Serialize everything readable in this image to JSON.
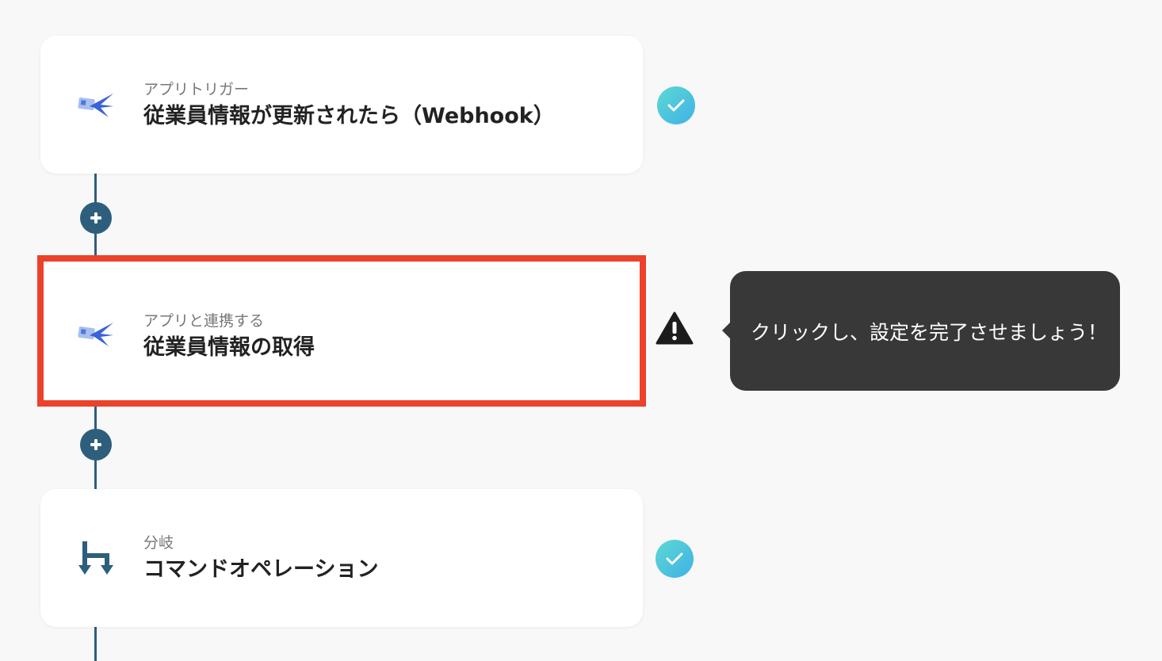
{
  "steps": [
    {
      "subtitle": "アプリトリガー",
      "title": "従業員情報が更新されたら（Webhook）",
      "icon": "app-bird-icon",
      "status": "complete"
    },
    {
      "subtitle": "アプリと連携する",
      "title": "従業員情報の取得",
      "icon": "app-bird-icon",
      "status": "warning",
      "highlighted": true
    },
    {
      "subtitle": "分岐",
      "title": "コマンドオペレーション",
      "icon": "branch-icon",
      "status": "complete"
    }
  ],
  "tooltip": {
    "text": "クリックし、設定を完了させましょう！"
  },
  "colors": {
    "flow_line": "#2d5f7c",
    "highlight_border": "#ec412b",
    "check_start": "#5dd9d3",
    "check_end": "#3fb1e6",
    "tooltip_bg": "#383838",
    "background": "#f8f8f8"
  }
}
